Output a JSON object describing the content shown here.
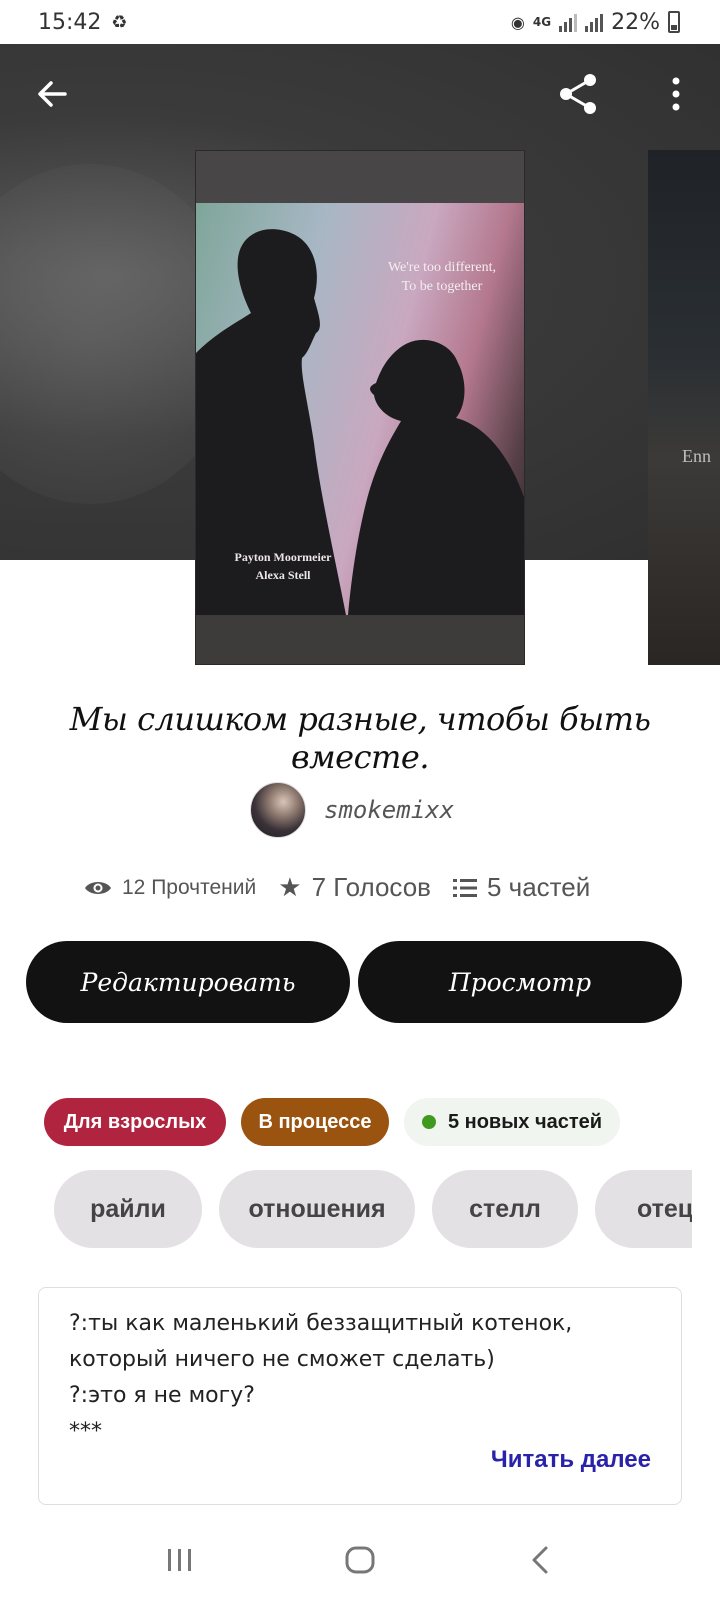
{
  "status_bar": {
    "time": "15:42",
    "network": "4G",
    "battery": "22%"
  },
  "cover": {
    "quote_line1": "We're too different,",
    "quote_line2": "To be together",
    "name1": "Payton Moormeier",
    "name2": "Alexa Stell",
    "next_cover_text": "Enn"
  },
  "story": {
    "title": "Мы слишком разные, чтобы быть вместе."
  },
  "author": {
    "name": "smokemixx"
  },
  "stats": {
    "reads": "12 Прочтений",
    "votes": "7 Голосов",
    "parts": "5 частей"
  },
  "actions": {
    "edit_label": "Редактировать",
    "preview_label": "Просмотр"
  },
  "badges": {
    "mature": "Для взрослых",
    "ongoing": "В процессе",
    "new_parts": "5 новых частей"
  },
  "tags": [
    "райли",
    "отношения",
    "стелл",
    "отец"
  ],
  "description": {
    "lines": [
      "?:ты как маленький беззащитный котенок,",
      "который ничего не сможет сделать)",
      "?:это я не могу?",
      "***"
    ],
    "read_more": "Читать далее"
  },
  "colors": {
    "button_bg": "#121212",
    "mature_badge": "#b0243f",
    "ongoing_badge": "#9a5410",
    "new_dot": "#3f9a1f",
    "read_more": "#2a22a8"
  }
}
